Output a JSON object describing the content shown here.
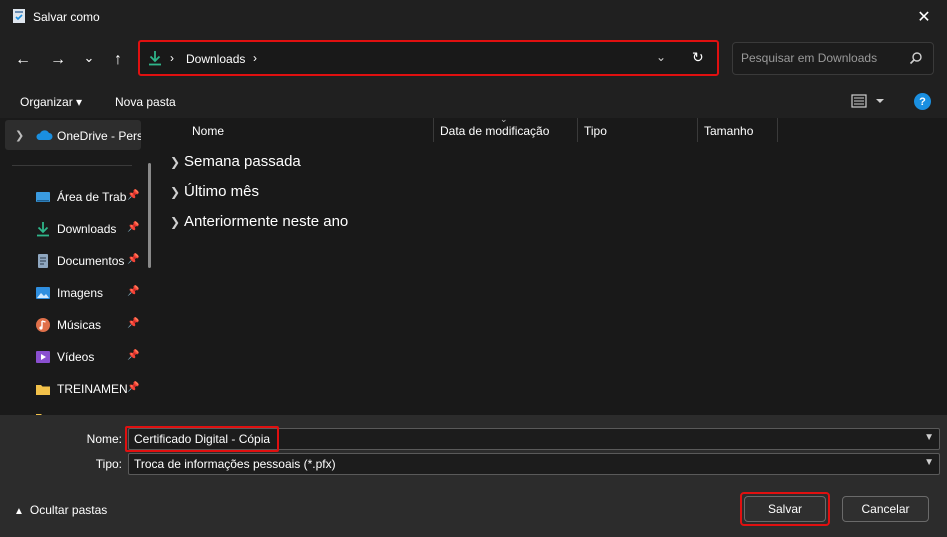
{
  "window": {
    "title": "Salvar como",
    "close_glyph": "✕"
  },
  "nav": {
    "back_glyph": "←",
    "forward_glyph": "→",
    "recent_glyph": "⌄",
    "up_glyph": "↑"
  },
  "address_bar": {
    "separator": "›",
    "path": "Downloads",
    "dropdown_glyph": "⌄",
    "refresh_glyph": "↻"
  },
  "search": {
    "placeholder": "Pesquisar em Downloads"
  },
  "toolbar": {
    "organize_label": "Organizar ▾",
    "new_folder_label": "Nova pasta",
    "help_label": "?"
  },
  "sidebar": {
    "onedrive_label": "OneDrive - Personal",
    "items": [
      {
        "label": "Área de Trabalho",
        "icon": "desktop-icon"
      },
      {
        "label": "Downloads",
        "icon": "download-icon"
      },
      {
        "label": "Documentos",
        "icon": "document-icon"
      },
      {
        "label": "Imagens",
        "icon": "image-icon"
      },
      {
        "label": "Músicas",
        "icon": "music-icon"
      },
      {
        "label": "Vídeos",
        "icon": "video-icon"
      },
      {
        "label": "TREINAMENTO",
        "icon": "folder-icon"
      }
    ]
  },
  "file_list": {
    "columns": [
      "Nome",
      "Data de modificação",
      "Tipo",
      "Tamanho"
    ],
    "groups": [
      "Semana passada",
      "Último mês",
      "Anteriormente neste ano"
    ]
  },
  "form": {
    "name_label": "Nome:",
    "name_value": "Certificado Digital - Cópia",
    "type_label": "Tipo:",
    "type_value": "Troca de informações pessoais (*.pfx)"
  },
  "footer": {
    "hide_folders_label": "Ocultar pastas",
    "save_label": "Salvar",
    "cancel_label": "Cancelar"
  },
  "colors": {
    "accent": "#1a8fe0",
    "highlight": "#e01010",
    "download_green": "#2fb58a"
  }
}
